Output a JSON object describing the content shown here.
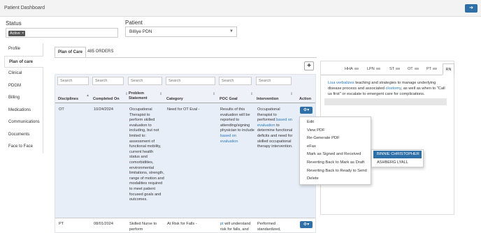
{
  "header": {
    "title": "Patient Dashboard",
    "logout_icon": "logout-icon"
  },
  "filters": {
    "status_label": "Status",
    "status_chip": "Active",
    "chip_remove": "×",
    "patient_label": "Patient",
    "patient_value": "Billiye PDN"
  },
  "sidebar": {
    "items": [
      {
        "label": "Profile"
      },
      {
        "label": "Plan of care"
      },
      {
        "label": "Clinical"
      },
      {
        "label": "PDGM"
      },
      {
        "label": "Billing"
      },
      {
        "label": "Medications"
      },
      {
        "label": "Communications"
      },
      {
        "label": "Documents"
      },
      {
        "label": "Face to Face"
      }
    ]
  },
  "tabs": [
    {
      "label": "Plan of Care"
    },
    {
      "label": "485 ORDERS"
    }
  ],
  "table": {
    "search_placeholder": "Search",
    "columns": [
      "Disciplines",
      "Completed On",
      "Problem Statement",
      "Category",
      "POC Goal",
      "Intervention",
      "Action"
    ],
    "rows": [
      {
        "discipline": "OT",
        "completed_on": "10/24/2024",
        "problem": "Occupational Therapist to perform skilled evaluation to including, but not limited to: assessment of functional mobility, current health status and comorbidities, environmental limitations, strength, range of motion and modalities required to meet patient focused goals and outcomes.",
        "category": "Need for OT Eval -",
        "goal_pre": "Results of this evaluation will be reported to attending/signing physician to include ",
        "goal_link": "based on evaluation",
        "intervention_pre": "Occupational therapist to performed ",
        "intervention_link": "based on evaluation",
        "intervention_post": " to determine functional deficits and need for skilled occupational therapy intervention."
      },
      {
        "discipline": "PT",
        "completed_on": "08/01/2024",
        "problem": "Skilled Nurse to perform standardized",
        "category": "At Risk for Falls -",
        "goal_link": "pt",
        "goal_post": " will understand risk for falls, and",
        "intervention": "Performed standardized, multifactoral fall"
      }
    ]
  },
  "action_menu": {
    "items": [
      {
        "label": "Edit"
      },
      {
        "label": "View PDF"
      },
      {
        "label": "Re-Generate PDF"
      },
      {
        "label": "eFax"
      },
      {
        "label": "Mark as Signed and Received"
      },
      {
        "label": "Reverting Back to Mark as Draft"
      },
      {
        "label": "Reverting Back to Ready to Send"
      },
      {
        "label": "Delete"
      }
    ]
  },
  "submenu": {
    "items": [
      {
        "label": "BINNIE CHRISTOPHER"
      },
      {
        "label": "ASHBERG LYALL"
      }
    ]
  },
  "right_panel": {
    "tabs": [
      {
        "label": "HHA"
      },
      {
        "label": "LPN"
      },
      {
        "label": "ST"
      },
      {
        "label": "OT"
      },
      {
        "label": "PT"
      },
      {
        "label": "RN"
      }
    ],
    "text_link1": "Lisa verbalizes",
    "text_mid": " teaching and strategies to manage underlying disease process and associated ",
    "text_link2": "clostomy",
    "text_post": ", as well as when to \"Call us first\" or escalate to emergent care for complications."
  },
  "colors": {
    "accent": "#2f6fa8",
    "link": "#2a7ab8",
    "row_highlight": "#e8eef7"
  }
}
